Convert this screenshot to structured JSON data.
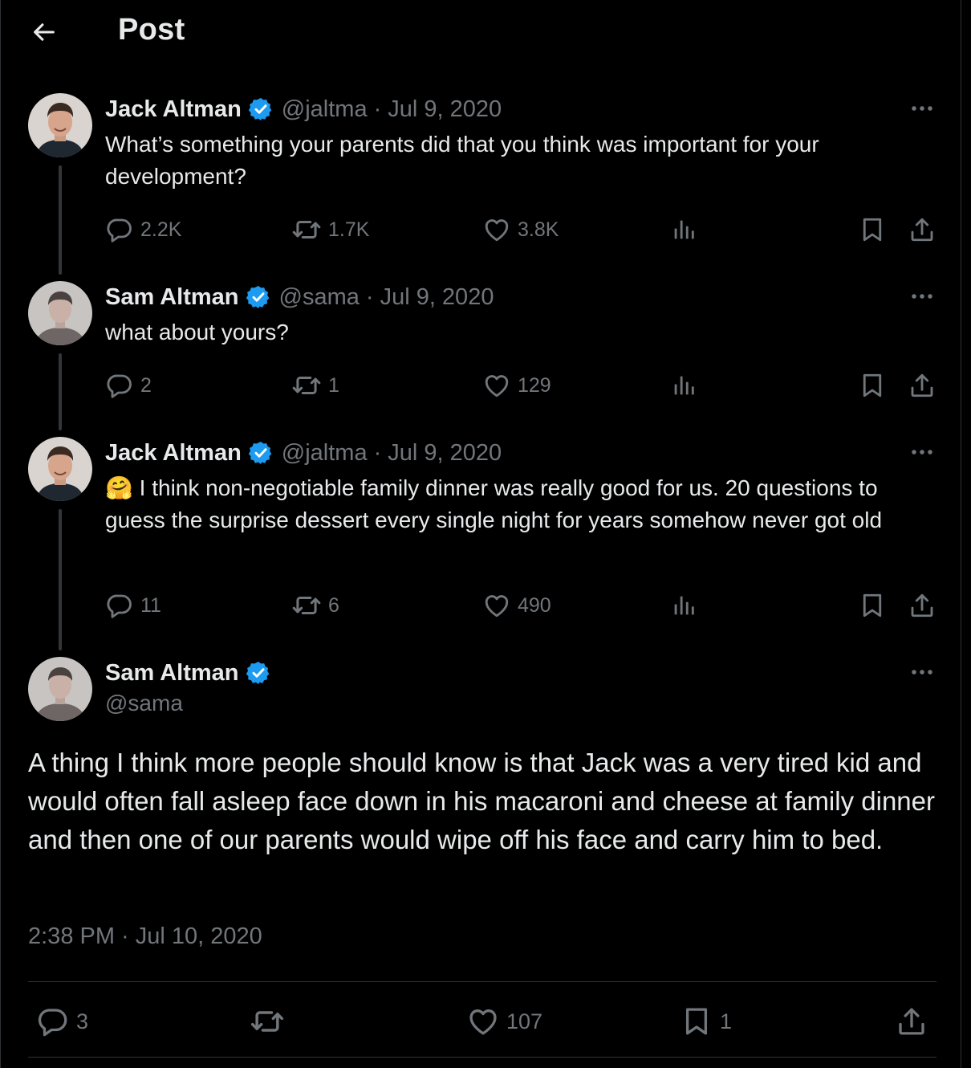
{
  "header": {
    "title": "Post"
  },
  "colors": {
    "background": "#000000",
    "text": "#e7e9ea",
    "muted": "#71767b",
    "verified": "#1d9bf0",
    "border": "#2f3336"
  },
  "tweets": [
    {
      "name": "Jack Altman",
      "handle": "@jaltma",
      "sep": "·",
      "date": "Jul 9, 2020",
      "text": "What’s something your parents did that you think was important for your development?",
      "replies": "2.2K",
      "retweets": "1.7K",
      "likes": "3.8K"
    },
    {
      "name": "Sam Altman",
      "handle": "@sama",
      "sep": "·",
      "date": "Jul 9, 2020",
      "text": "what about yours?",
      "replies": "2",
      "retweets": "1",
      "likes": "129"
    },
    {
      "name": "Jack Altman",
      "handle": "@jaltma",
      "sep": "·",
      "date": "Jul 9, 2020",
      "emoji": "🤗",
      "text": "I think non-negotiable family dinner was really good for us. 20 questions to guess the surprise dessert every single night for years somehow never got old",
      "replies": "11",
      "retweets": "6",
      "likes": "490"
    }
  ],
  "main_post": {
    "name": "Sam Altman",
    "handle": "@sama",
    "text": "A thing I think more people should know is that Jack was a very tired kid and would often fall asleep face down in his macaroni and cheese at family dinner and then one of our parents would wipe off his face and carry him to bed.",
    "timestamp": "2:38 PM · Jul 10, 2020",
    "replies": "3",
    "likes": "107",
    "bookmarks": "1"
  },
  "icons": [
    "back-arrow-icon",
    "verified-badge-icon",
    "more-icon",
    "reply-icon",
    "retweet-icon",
    "like-icon",
    "views-icon",
    "bookmark-icon",
    "share-icon"
  ]
}
